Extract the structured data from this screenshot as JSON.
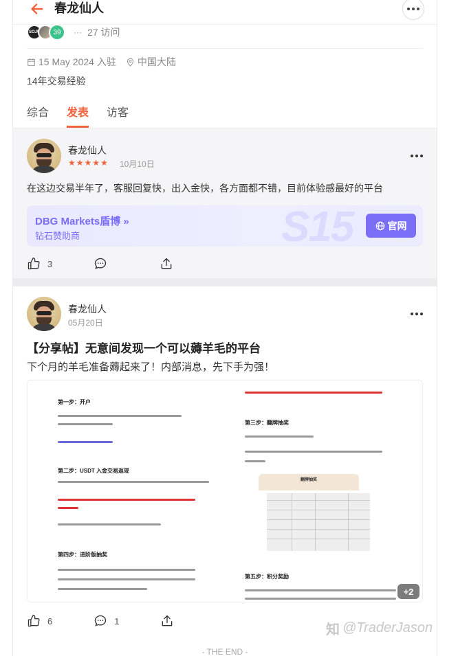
{
  "header": {
    "title": "春龙仙人"
  },
  "followers": {
    "avatar1_text": "SOJU",
    "count_badge": "39",
    "separator": "···",
    "visits": "27 访问"
  },
  "profile": {
    "joined": "15 May 2024 入驻",
    "location": "中国大陆",
    "bio": "14年交易经验"
  },
  "tabs": [
    {
      "label": "综合",
      "active": false
    },
    {
      "label": "发表",
      "active": true
    },
    {
      "label": "访客",
      "active": false
    }
  ],
  "posts": [
    {
      "author": "春龙仙人",
      "rating": 5,
      "date": "10月10日",
      "text": "在这边交易半年了，客服回复快，出入金快，各方面都不错，目前体验感最好的平台",
      "broker": {
        "name": "DBG Markets盾博",
        "tag": "钻石赞助商",
        "button": "官网",
        "watermark": "S15"
      },
      "likes": "3"
    },
    {
      "author": "春龙仙人",
      "date": "05月20日",
      "title": "【分享帖】无意间发现一个可以薅羊毛的平台",
      "text": "下个月的羊毛准备薅起来了！内部消息，先下手为强！",
      "image_extra": "+2",
      "likes": "6",
      "comments": "1",
      "doc_headings": {
        "s1": "第一步：开户",
        "s2": "第二步：USDT 入金交易返现",
        "s3": "第三步：翻牌抽奖",
        "s4": "第四步：进阶版抽奖",
        "s5": "第五步：积分奖励",
        "board": "翻牌抽奖"
      }
    }
  ],
  "footer": {
    "end": "- THE END -",
    "watermark": "@TraderJason"
  },
  "colors": {
    "accent": "#f0643c",
    "broker": "#7b6ef6"
  }
}
